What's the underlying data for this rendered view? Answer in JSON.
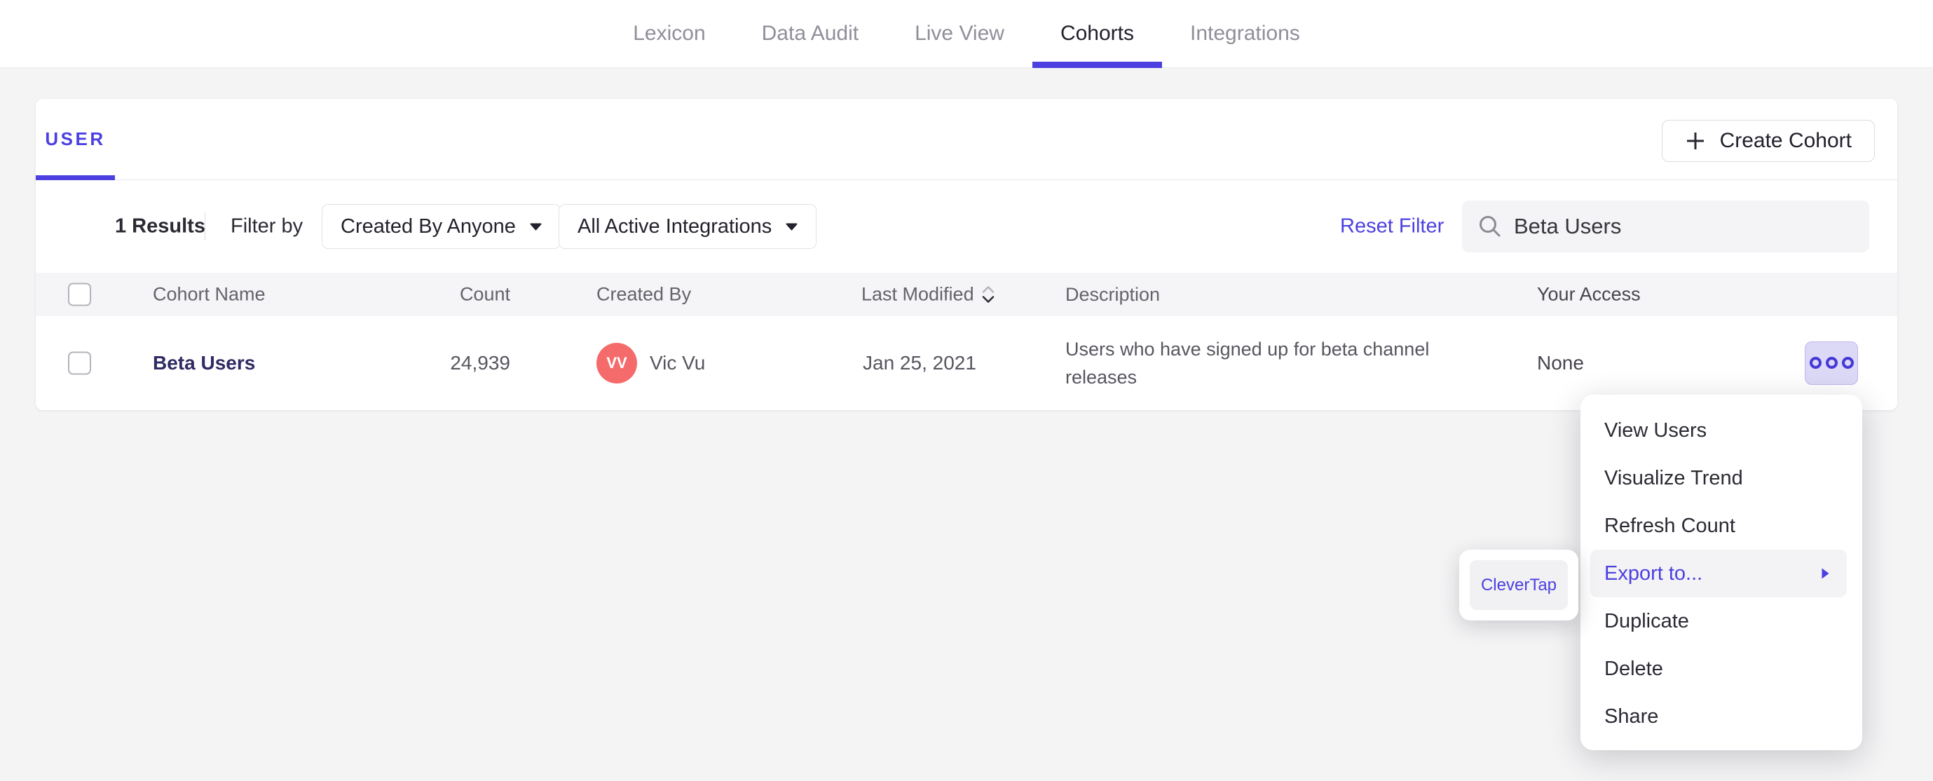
{
  "nav": {
    "active": "Cohorts",
    "items": [
      {
        "label": "Lexicon"
      },
      {
        "label": "Data Audit"
      },
      {
        "label": "Live View"
      },
      {
        "label": "Cohorts"
      },
      {
        "label": "Integrations"
      }
    ]
  },
  "panel": {
    "tab_label": "USER",
    "create_button_label": "Create Cohort"
  },
  "filters": {
    "results": "1 Results",
    "filter_by_label": "Filter by",
    "created_by_value": "Created By Anyone",
    "integrations_value": "All Active Integrations",
    "reset_label": "Reset Filter",
    "search_value": "Beta Users"
  },
  "table": {
    "headers": [
      "Cohort Name",
      "Count",
      "Created By",
      "Last Modified",
      "Description",
      "Your Access"
    ],
    "row": {
      "name": "Beta Users",
      "count": "24,939",
      "creator_initials": "VV",
      "creator_name": "Vic Vu",
      "last_modified": "Jan 25, 2021",
      "description": "Users who have signed up for beta channel releases",
      "access": "None"
    }
  },
  "menu": {
    "items": [
      {
        "label": "View Users"
      },
      {
        "label": "Visualize Trend"
      },
      {
        "label": "Refresh Count"
      },
      {
        "label": "Export to...",
        "highlighted": true
      },
      {
        "label": "Duplicate"
      },
      {
        "label": "Delete"
      },
      {
        "label": "Share"
      }
    ],
    "submenu": {
      "label": "CleverTap"
    }
  },
  "colors": {
    "accent": "#4c40e0",
    "avatar_bg": "#f56b6b",
    "row_link": "#2f2b63",
    "page_bg": "#f4f4f5",
    "menu_highlight_bg": "#f3f3f6"
  }
}
